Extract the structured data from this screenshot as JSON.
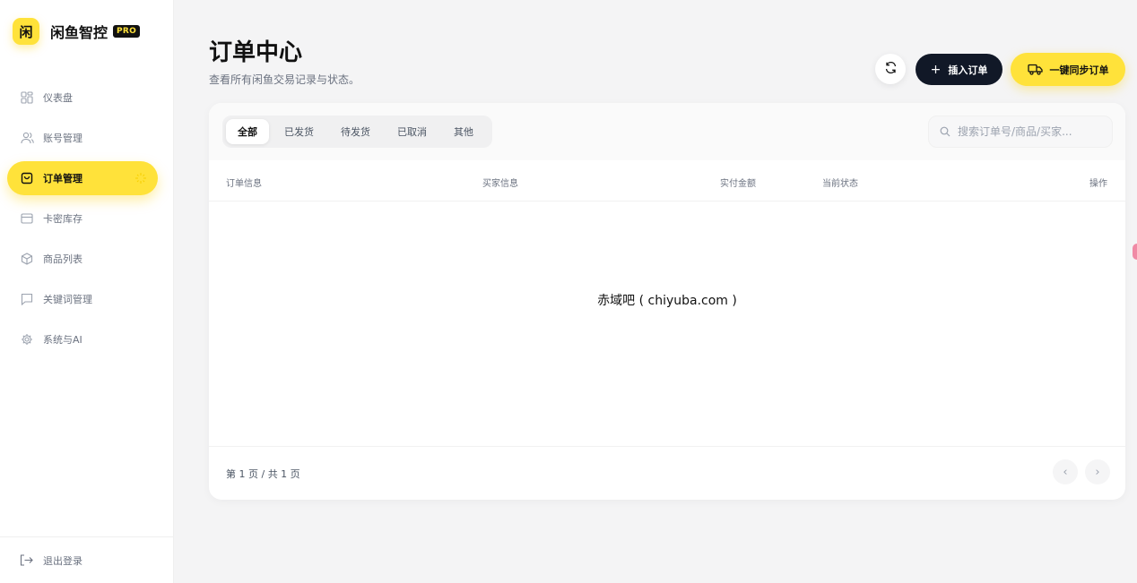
{
  "brand": {
    "logo_char": "闲",
    "name": "闲鱼智控",
    "badge": "PRO"
  },
  "sidebar": {
    "items": [
      {
        "label": "仪表盘",
        "icon": "grid-icon"
      },
      {
        "label": "账号管理",
        "icon": "users-icon"
      },
      {
        "label": "订单管理",
        "icon": "bag-icon",
        "active": true
      },
      {
        "label": "卡密库存",
        "icon": "card-icon"
      },
      {
        "label": "商品列表",
        "icon": "box-icon"
      },
      {
        "label": "关键词管理",
        "icon": "message-icon"
      },
      {
        "label": "系统与AI",
        "icon": "gear-icon"
      }
    ],
    "logout_label": "退出登录"
  },
  "header": {
    "title": "订单中心",
    "subtitle": "查看所有闲鱼交易记录与状态。",
    "insert_label": "插入订单",
    "sync_label": "一键同步订单"
  },
  "tabs": [
    {
      "label": "全部",
      "active": true
    },
    {
      "label": "已发货"
    },
    {
      "label": "待发货"
    },
    {
      "label": "已取消"
    },
    {
      "label": "其他"
    }
  ],
  "search": {
    "placeholder": "搜索订单号/商品/买家..."
  },
  "table": {
    "columns": [
      "订单信息",
      "买家信息",
      "实付金额",
      "当前状态",
      "操作"
    ],
    "empty_text": "赤域吧 ( chiyuba.com )"
  },
  "pagination": {
    "info": "第 1 页 / 共 1 页",
    "prev": "‹",
    "next": "›"
  },
  "colors": {
    "accent": "#ffe23a",
    "dark": "#111827",
    "background": "#f4f4f5"
  }
}
